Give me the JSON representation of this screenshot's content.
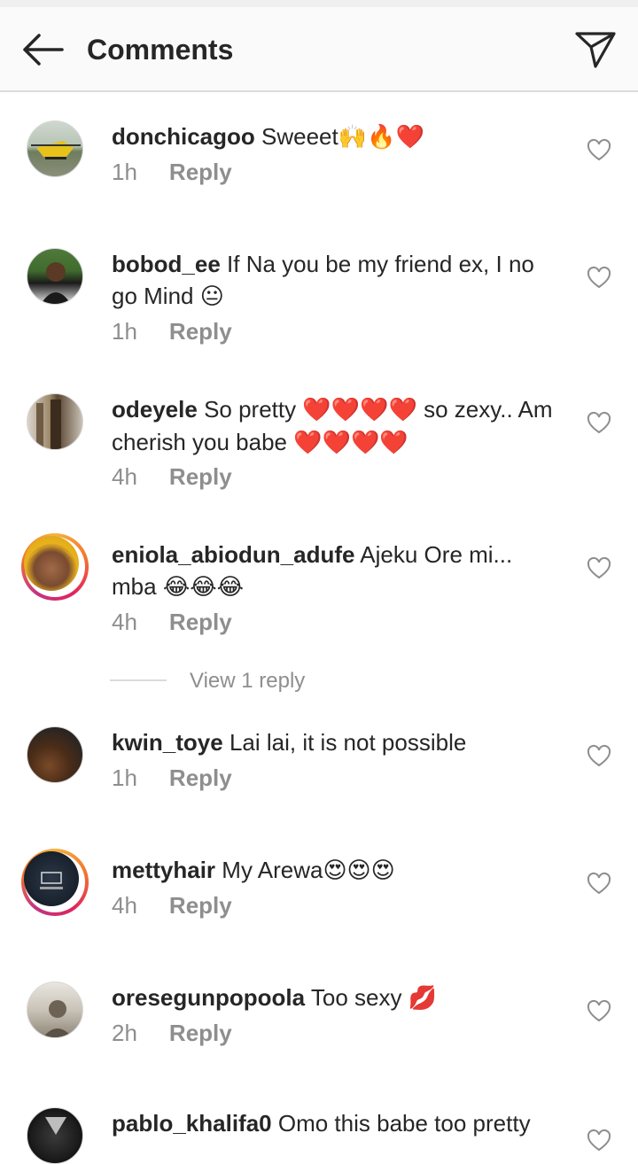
{
  "header": {
    "title": "Comments",
    "back_icon": "arrow-left-icon",
    "share_icon": "paper-plane-icon"
  },
  "colors": {
    "text": "#262626",
    "secondary": "#8e8e8e",
    "divider": "#dbdbdb",
    "heart": "#e0245e"
  },
  "comments": [
    {
      "username": "donchicagoo",
      "text": "Sweeet",
      "emoji": "🙌🔥❤️",
      "time": "1h",
      "reply": "Reply",
      "text_cont": ""
    },
    {
      "username": "bobod_ee",
      "text": "If Na you be my friend ex, I no go Mind",
      "emoji": "😐",
      "time": "1h",
      "reply": "Reply"
    },
    {
      "username": "odeyele",
      "text": "So pretty",
      "emoji": "❤️❤️❤️❤️",
      "text2": "so zexy.. Am cherish you babe",
      "emoji2": "❤️❤️❤️❤️",
      "time": "4h",
      "reply": "Reply"
    },
    {
      "username": "eniola_abiodun_adufe",
      "text": "Ajeku Ore mi... mba",
      "emoji": "😂😂😂",
      "time": "4h",
      "reply": "Reply"
    },
    {
      "username": "kwin_toye",
      "text": "Lai lai, it is not possible",
      "emoji": "",
      "time": "1h",
      "reply": "Reply"
    },
    {
      "username": "mettyhair",
      "text": "My Arewa",
      "emoji": "😍😍😍",
      "time": "4h",
      "reply": "Reply"
    },
    {
      "username": "oresegunpopoola",
      "text": "Too sexy",
      "emoji": "💋",
      "time": "2h",
      "reply": "Reply"
    },
    {
      "username": "pablo_khalifa0",
      "text": "Omo this babe too pretty",
      "emoji": "",
      "time": "",
      "reply": ""
    }
  ],
  "view_replies": "View 1 reply"
}
